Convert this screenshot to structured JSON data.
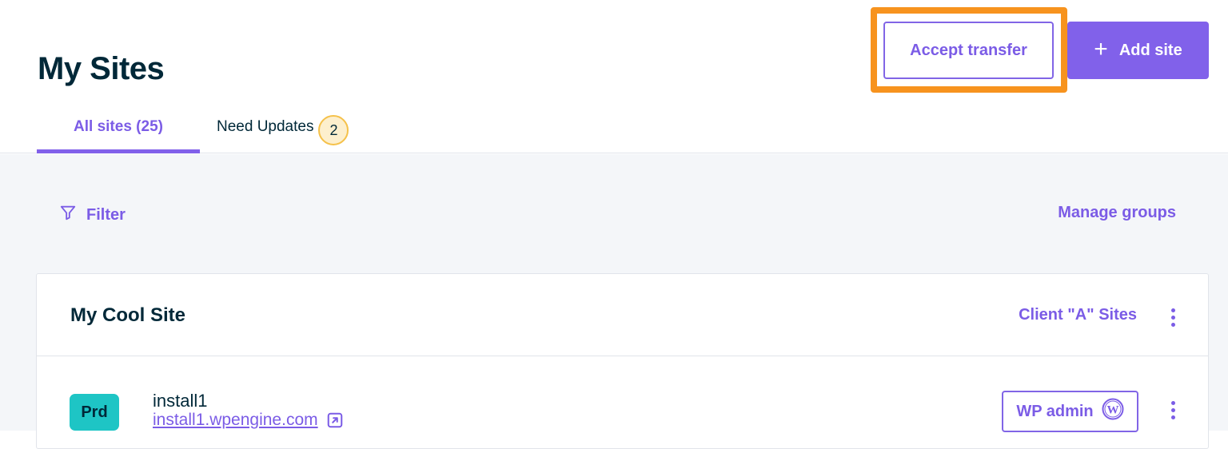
{
  "header": {
    "title": "My Sites",
    "accept_transfer_label": "Accept transfer",
    "add_site_label": "Add site"
  },
  "tabs": [
    {
      "label": "All sites (25)",
      "active": true
    },
    {
      "label": "Need Updates",
      "badge": "2",
      "active": false
    }
  ],
  "toolbar": {
    "filter_label": "Filter",
    "manage_groups_label": "Manage groups"
  },
  "site": {
    "name": "My Cool Site",
    "group": "Client \"A\" Sites",
    "installs": [
      {
        "environment": "Prd",
        "name": "install1",
        "url": "install1.wpengine.com",
        "wp_admin_label": "WP admin"
      }
    ]
  },
  "icons": {
    "add": "plus-icon",
    "filter": "filter-icon",
    "more": "kebab-menu-icon",
    "external": "external-link-icon",
    "wordpress": "wordpress-icon"
  },
  "colors": {
    "accent": "#7b5ce6",
    "primary_button": "#8161ea",
    "highlight": "#f7931e",
    "badge_bg": "#fdefcd",
    "env_prd": "#1ec5c5",
    "text": "#002838"
  }
}
